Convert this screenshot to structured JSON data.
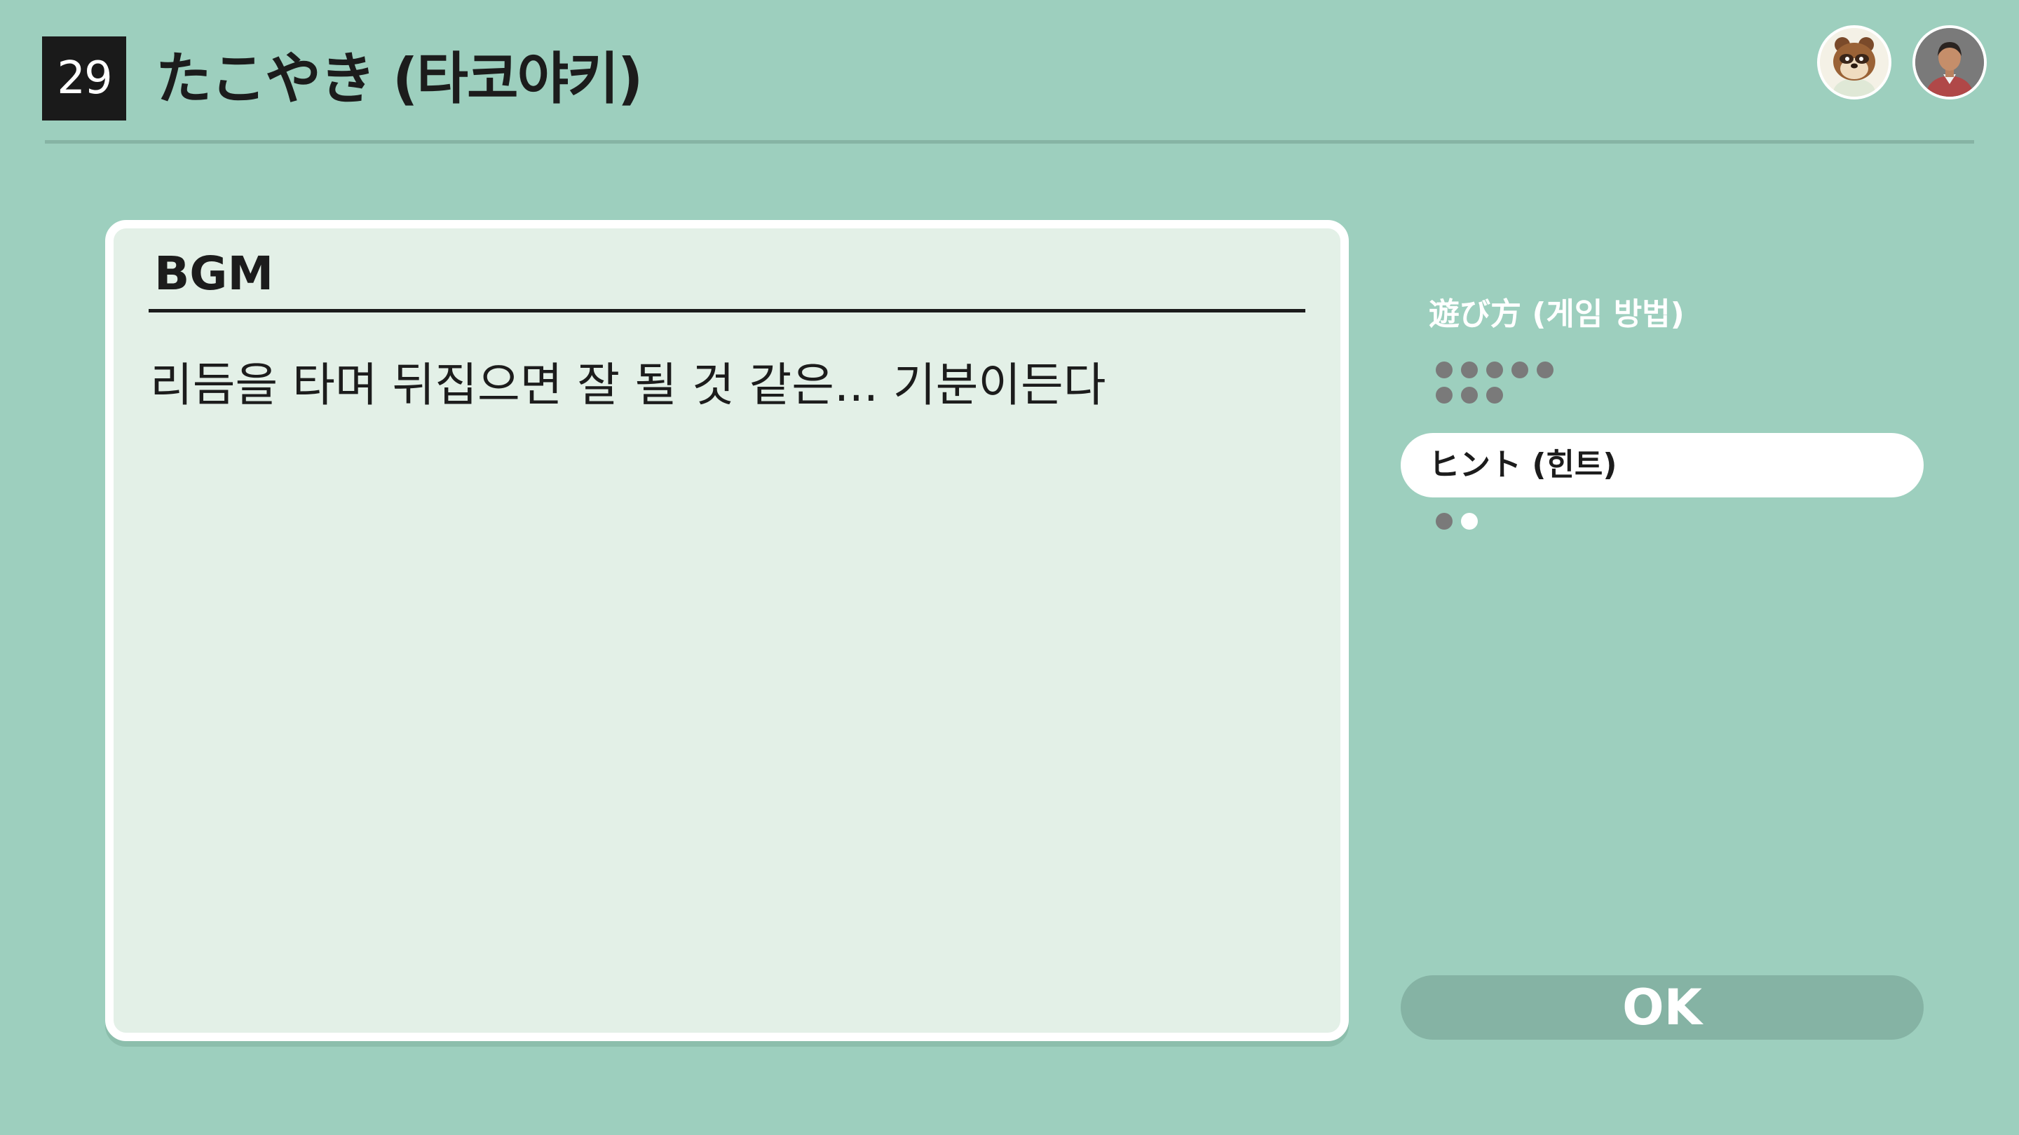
{
  "header": {
    "game_number": "29",
    "title": "たこやき (타코야키)",
    "avatars": [
      {
        "icon": "raccoon-character-avatar-icon"
      },
      {
        "icon": "user-avatar-icon"
      }
    ]
  },
  "card": {
    "heading": "BGM",
    "body": "리듬을 타며 뒤집으면 잘 될 것 같은... 기분이든다"
  },
  "menu": {
    "items": [
      {
        "label": "遊び方 (게임 방법)",
        "selected": false,
        "dots_total": 8,
        "dots_filled": 8
      },
      {
        "label": "ヒント (힌트)",
        "selected": true,
        "dots_total": 2,
        "dots_filled": 1
      }
    ]
  },
  "ok_button": {
    "label": "OK"
  },
  "colors": {
    "background": "#9dcfbe",
    "card_fill": "#e3f0e7",
    "ok_button": "#85b3a4",
    "dot_filled": "#7a7a7a",
    "dot_empty": "#ffffff"
  }
}
